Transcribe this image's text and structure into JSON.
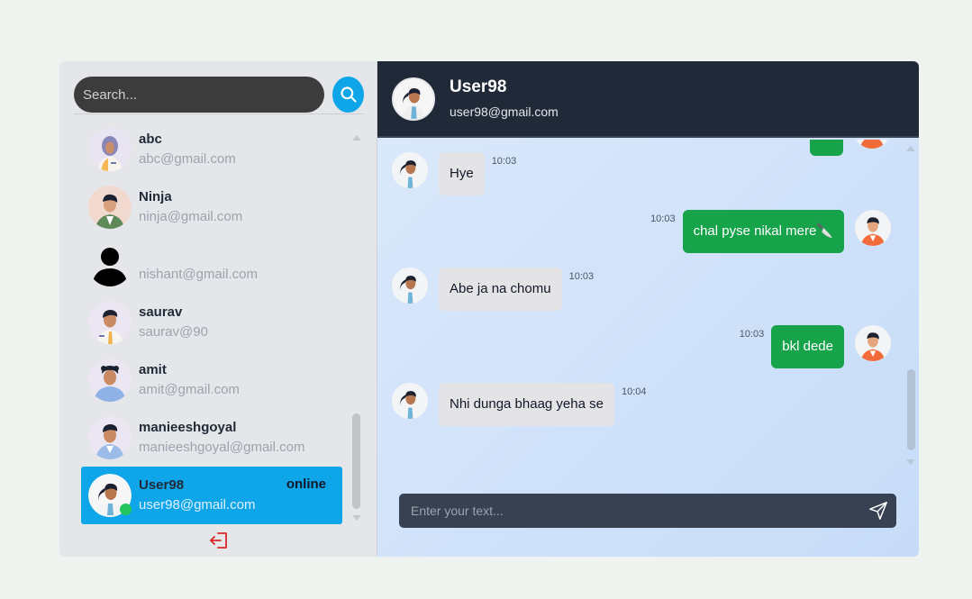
{
  "sidebar": {
    "search": {
      "placeholder": "Search..."
    },
    "contacts": [
      {
        "name": "abc",
        "email": "abc@gmail.com",
        "avatar": "hijab-woman-avatar"
      },
      {
        "name": "Ninja",
        "email": "ninja@gmail.com",
        "avatar": "man-green-shirt-avatar"
      },
      {
        "name": "",
        "email": "nishant@gmail.com",
        "avatar": "default-user-silhouette"
      },
      {
        "name": "saurav",
        "email": "saurav@90",
        "avatar": "man-tie-avatar"
      },
      {
        "name": "amit",
        "email": "amit@gmail.com",
        "avatar": "curly-hair-avatar"
      },
      {
        "name": "manieeshgoyal",
        "email": "manieeshgoyal@gmail.com",
        "avatar": "man-blue-shirt-avatar"
      },
      {
        "name": "User98",
        "email": "user98@gmail.com",
        "status": "online",
        "avatar": "woman-ponytail-avatar"
      }
    ],
    "logout_icon": "logout-icon"
  },
  "chat": {
    "header": {
      "name": "User98",
      "email": "user98@gmail.com"
    },
    "messages": [
      {
        "direction": "in",
        "text": "Hye",
        "time": "10:03"
      },
      {
        "direction": "out",
        "text": "chal pyse nikal mere🔪",
        "time": "10:03"
      },
      {
        "direction": "in",
        "text": "Abe ja na chomu",
        "time": "10:03"
      },
      {
        "direction": "out",
        "text": "bkl dede",
        "time": "10:03"
      },
      {
        "direction": "in",
        "text": "Nhi dunga bhaag yeha se",
        "time": "10:04"
      }
    ],
    "composer": {
      "placeholder": "Enter your text..."
    }
  },
  "colors": {
    "accent": "#0ea5e9",
    "outgoing_bubble": "#16a34a",
    "incoming_bubble": "#e4e4e7",
    "header_bg": "#1f2937",
    "online": "#22c55e",
    "logout": "#dc2626"
  }
}
